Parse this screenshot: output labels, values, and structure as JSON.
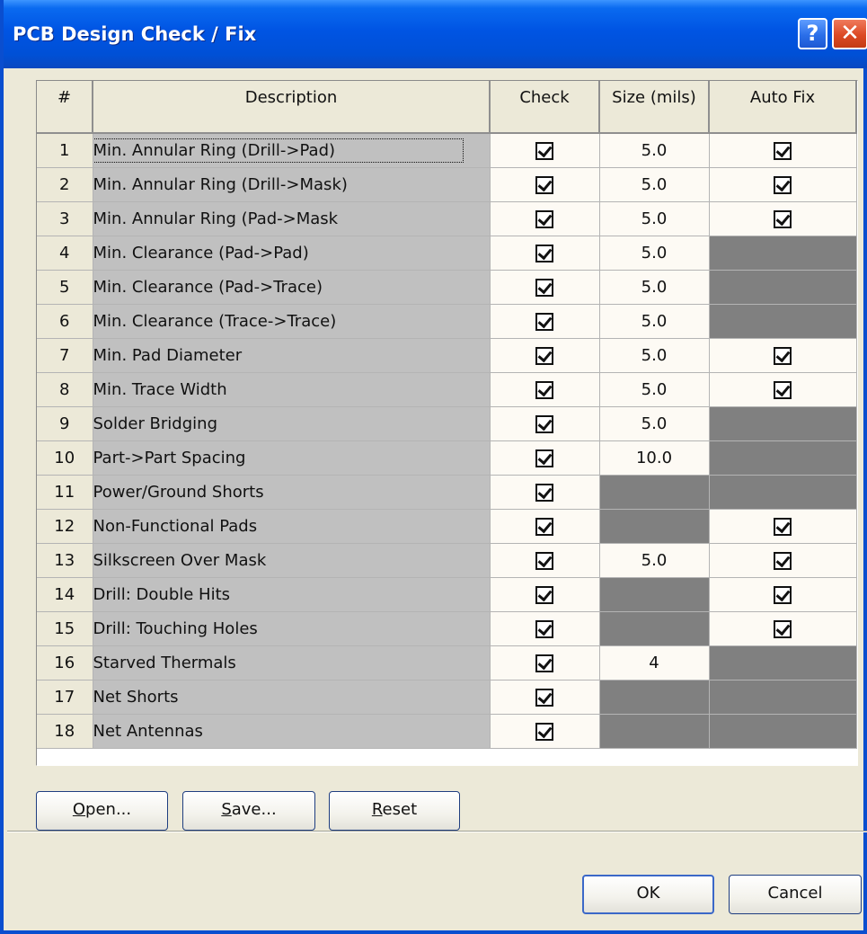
{
  "window": {
    "title": "PCB Design Check / Fix"
  },
  "titlebar": {
    "help_glyph": "?",
    "close_glyph": "✕"
  },
  "columns": {
    "num": "#",
    "description": "Description",
    "check": "Check",
    "size": "Size (mils)",
    "auto_fix": "Auto Fix"
  },
  "rows": [
    {
      "num": "1",
      "desc": "Min. Annular Ring (Drill->Pad)",
      "check": true,
      "size": "5.0",
      "size_na": false,
      "fix": true,
      "fix_na": false
    },
    {
      "num": "2",
      "desc": "Min. Annular Ring (Drill->Mask)",
      "check": true,
      "size": "5.0",
      "size_na": false,
      "fix": true,
      "fix_na": false
    },
    {
      "num": "3",
      "desc": "Min. Annular Ring (Pad->Mask",
      "check": true,
      "size": "5.0",
      "size_na": false,
      "fix": true,
      "fix_na": false
    },
    {
      "num": "4",
      "desc": "Min. Clearance (Pad->Pad)",
      "check": true,
      "size": "5.0",
      "size_na": false,
      "fix": false,
      "fix_na": true
    },
    {
      "num": "5",
      "desc": "Min. Clearance (Pad->Trace)",
      "check": true,
      "size": "5.0",
      "size_na": false,
      "fix": false,
      "fix_na": true
    },
    {
      "num": "6",
      "desc": "Min. Clearance (Trace->Trace)",
      "check": true,
      "size": "5.0",
      "size_na": false,
      "fix": false,
      "fix_na": true
    },
    {
      "num": "7",
      "desc": "Min. Pad Diameter",
      "check": true,
      "size": "5.0",
      "size_na": false,
      "fix": true,
      "fix_na": false
    },
    {
      "num": "8",
      "desc": "Min. Trace Width",
      "check": true,
      "size": "5.0",
      "size_na": false,
      "fix": true,
      "fix_na": false
    },
    {
      "num": "9",
      "desc": "Solder Bridging",
      "check": true,
      "size": "5.0",
      "size_na": false,
      "fix": false,
      "fix_na": true
    },
    {
      "num": "10",
      "desc": "Part->Part Spacing",
      "check": true,
      "size": "10.0",
      "size_na": false,
      "fix": false,
      "fix_na": true
    },
    {
      "num": "11",
      "desc": "Power/Ground Shorts",
      "check": true,
      "size": "",
      "size_na": true,
      "fix": false,
      "fix_na": true
    },
    {
      "num": "12",
      "desc": "Non-Functional Pads",
      "check": true,
      "size": "",
      "size_na": true,
      "fix": true,
      "fix_na": false
    },
    {
      "num": "13",
      "desc": "Silkscreen Over Mask",
      "check": true,
      "size": "5.0",
      "size_na": false,
      "fix": true,
      "fix_na": false
    },
    {
      "num": "14",
      "desc": "Drill: Double Hits",
      "check": true,
      "size": "",
      "size_na": true,
      "fix": true,
      "fix_na": false
    },
    {
      "num": "15",
      "desc": "Drill: Touching Holes",
      "check": true,
      "size": "",
      "size_na": true,
      "fix": true,
      "fix_na": false
    },
    {
      "num": "16",
      "desc": "Starved Thermals",
      "check": true,
      "size": "4",
      "size_na": false,
      "fix": false,
      "fix_na": true
    },
    {
      "num": "17",
      "desc": "Net Shorts",
      "check": true,
      "size": "",
      "size_na": true,
      "fix": false,
      "fix_na": true
    },
    {
      "num": "18",
      "desc": "Net Antennas",
      "check": true,
      "size": "",
      "size_na": true,
      "fix": false,
      "fix_na": true
    }
  ],
  "buttons": {
    "open": {
      "mnemonic": "O",
      "rest": "pen..."
    },
    "save": {
      "mnemonic": "S",
      "rest": "ave..."
    },
    "reset": {
      "mnemonic": "R",
      "rest": "eset"
    },
    "ok": "OK",
    "cancel": "Cancel"
  },
  "colors": {
    "titlebar": "#0054e3",
    "dialog_bg": "#ece9d8",
    "disabled_cell": "#808080",
    "description_bg": "#c0c0c0"
  }
}
